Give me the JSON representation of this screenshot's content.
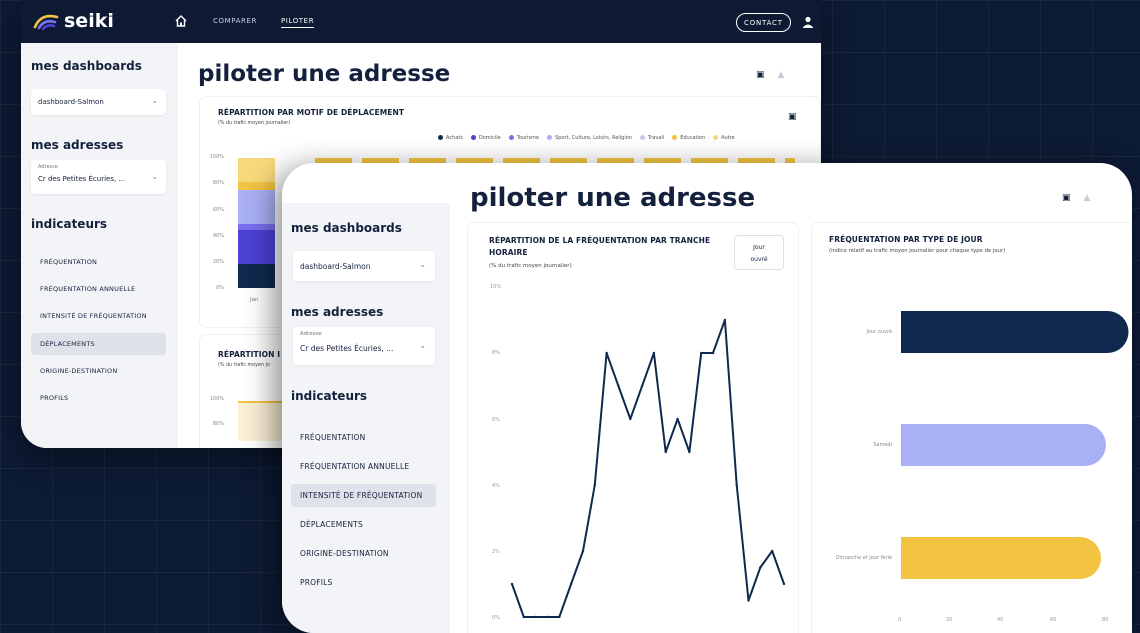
{
  "colors": {
    "navy": "#0e1a34",
    "dark_blue": "#0f2a4e",
    "royal_blue": "#4c42d6",
    "violet": "#7a6ff0",
    "periwinkle": "#aab0f5",
    "yellow": "#f2c441",
    "light_yellow": "#f8d97a"
  },
  "app": {
    "brand": "seiki",
    "nav": [
      {
        "label": "COMPARER",
        "active": false
      },
      {
        "label": "PILOTER",
        "active": true
      }
    ],
    "contact_label": "CONTACT"
  },
  "sidebar": {
    "dashboards_heading": "mes dashboards",
    "dashboard_value": "dashboard-Salmon",
    "adresses_heading": "mes adresses",
    "address_label": "Adresse",
    "address_value": "Cr des Petites Écuries, ...",
    "indicateurs_heading": "indicateurs",
    "items": [
      {
        "label": "FRÉQUENTATION"
      },
      {
        "label": "FRÉQUENTATION ANNUELLE"
      },
      {
        "label": "INTENSITÉ DE FRÉQUENTATION"
      },
      {
        "label": "DÉPLACEMENTS"
      },
      {
        "label": "ORIGINE-DESTINATION"
      },
      {
        "label": "PROFILS"
      }
    ]
  },
  "back": {
    "page_title": "piloter une adresse",
    "card1_title": "RÉPARTITION PAR MOTIF DE DÉPLACEMENT",
    "card1_subtitle": "(% du trafic moyen journalier)",
    "legend": [
      "Achats",
      "Domicile",
      "Tourisme",
      "Sport, Culture, Loisirs, Religion",
      "Travail",
      "Éducation",
      "Autre"
    ],
    "y_ticks": [
      "100%",
      "80%",
      "60%",
      "40%",
      "20%",
      "0%"
    ],
    "first_category": "Jan",
    "card2_title": "RÉPARTITION I",
    "card2_subtitle": "(% du trafic moyen jo",
    "card2_y_ticks": [
      "100%",
      "80%"
    ]
  },
  "front": {
    "page_title": "piloter une adresse",
    "line_card": {
      "title": "RÉPARTITION DE LA FRÉQUENTATION PAR TRANCHE HORAIRE",
      "subtitle": "(% du trafic moyen journalier)",
      "button_line1": "Jour",
      "button_line2": "ouvré",
      "y_ticks": [
        "10%",
        "8%",
        "6%",
        "4%",
        "2%",
        "0%"
      ]
    },
    "bar_card": {
      "title": "FRÉQUENTATION PAR TYPE DE JOUR",
      "subtitle": "(indice relatif au trafic moyen journalier pour chaque type de jour)",
      "bars": [
        {
          "label": "Jour ouvré",
          "value": 91,
          "color": "#0f2a4e"
        },
        {
          "label": "Samedi",
          "value": 82,
          "color": "#aab0f5"
        },
        {
          "label": "Dimanche et jour férié",
          "value": 80,
          "color": "#f2c441"
        }
      ],
      "x_ticks": [
        "0",
        "20",
        "40",
        "60",
        "80",
        "100"
      ]
    }
  },
  "chart_data": [
    {
      "type": "line",
      "title": "RÉPARTITION DE LA FRÉQUENTATION PAR TRANCHE HORAIRE",
      "ylabel": "% du trafic moyen journalier",
      "ylim": [
        0,
        10
      ],
      "x": [
        0,
        1,
        2,
        3,
        4,
        5,
        6,
        7,
        8,
        9,
        10,
        11,
        12,
        13,
        14,
        15,
        16,
        17,
        18,
        19,
        20,
        21,
        22,
        23
      ],
      "series": [
        {
          "values": [
            1.0,
            0.0,
            0.0,
            0.0,
            0.0,
            1.0,
            2.0,
            4.0,
            8.0,
            7.0,
            6.0,
            7.0,
            8.0,
            5.0,
            6.0,
            5.0,
            8.0,
            8.0,
            9.0,
            4.0,
            0.5,
            1.5,
            2.0,
            1.0
          ]
        }
      ]
    },
    {
      "type": "bar",
      "title": "FRÉQUENTATION PAR TYPE DE JOUR",
      "categories": [
        "Jour ouvré",
        "Samedi",
        "Dimanche et jour férié"
      ],
      "values": [
        91,
        82,
        80
      ],
      "xlim": [
        0,
        100
      ]
    }
  ]
}
